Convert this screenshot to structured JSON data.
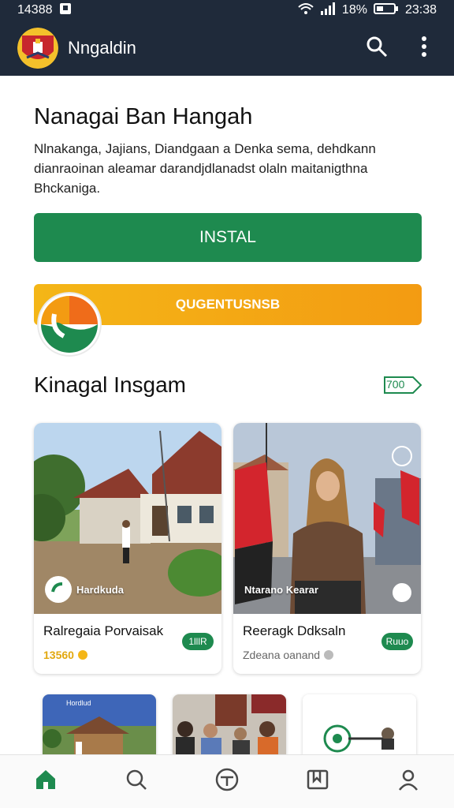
{
  "status_bar": {
    "time_left": "14388",
    "battery_percent": "18%",
    "time_right": "23:38"
  },
  "app_bar": {
    "title": "Nngaldin",
    "search_icon": "search-icon",
    "menu_icon": "more-vert-icon"
  },
  "hero": {
    "title": "Nanagai Ban Hangah",
    "description": "Nlnakanga, Jajians, Diandgaan a Denka sema, dehdkann dianraoinan aleamar darandjdlanadst olaln maitanigthna Bhckaniga.",
    "install_label": "INSTAL",
    "promo_label": "QUGENTUSNSB"
  },
  "section": {
    "title": "Kinagal Insgam",
    "see_all_label": "700"
  },
  "cards": [
    {
      "overlay_label": "Hardkuda",
      "title": "Ralregaia Porvaisak",
      "meta": "13560",
      "badge": "1lllR"
    },
    {
      "overlay_label": "Ntarano Kearar",
      "title": "Reeragk Ddksaln",
      "meta": "Zdeana oanand",
      "badge": "Ruuo"
    }
  ],
  "thumbnails": [
    {
      "label": "Hordlud"
    },
    {
      "label": ""
    },
    {
      "label": ""
    }
  ],
  "colors": {
    "app_bar": "#1f2a3a",
    "primary_green": "#1e8a4f",
    "promo_orange": "#f4b617",
    "meta_gold": "#e2a80f"
  },
  "bottom_nav": [
    "home-icon",
    "search-icon",
    "explore-icon",
    "bookmark-book-icon",
    "profile-icon"
  ]
}
